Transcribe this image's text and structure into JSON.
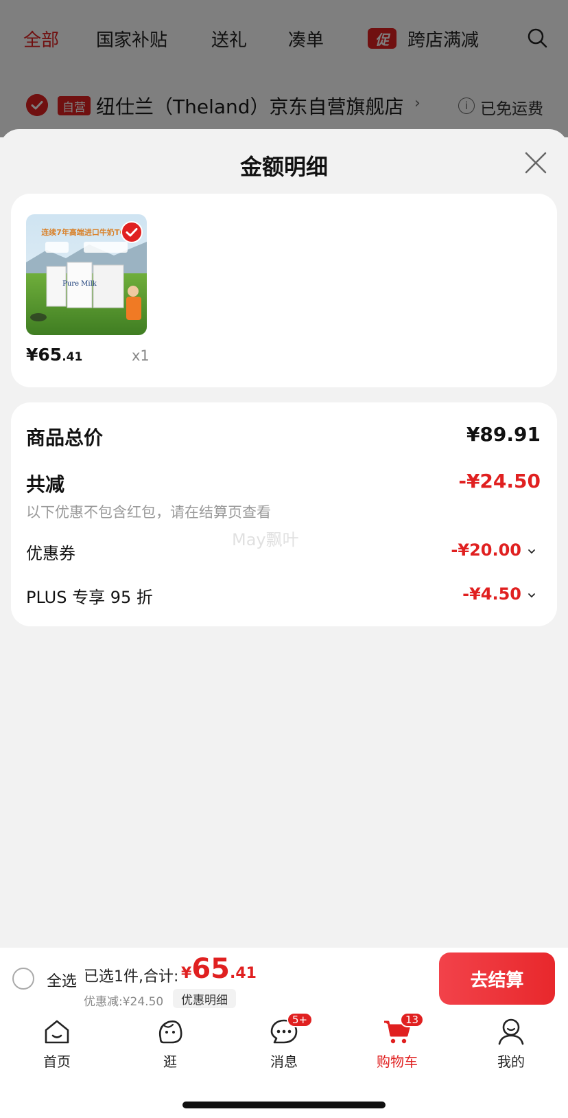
{
  "top_tabs": {
    "all": "全部",
    "national_subsidy": "国家补贴",
    "gift": "送礼",
    "bundle": "凑单",
    "promo_badge": "促",
    "cross_store": "跨店满减"
  },
  "store": {
    "self_operated_badge": "自营",
    "name": "纽仕兰（Theland）京东自营旗舰店",
    "chevron": "›",
    "info_icon": "i",
    "shipping": "已免运费"
  },
  "sheet": {
    "title": "金额明细"
  },
  "product": {
    "price_int": "¥65",
    "price_dec": ".41",
    "quantity": "x1",
    "image_banner": "连续7年高端进口牛奶TOP",
    "image_brand": "Pure Milk"
  },
  "details": {
    "total_label": "商品总价",
    "total_value": "¥89.91",
    "reduce_label": "共减",
    "reduce_value": "-¥24.50",
    "note": "以下优惠不包含红包，请在结算页查看",
    "coupon_label": "优惠券",
    "coupon_value": "-¥20.00",
    "plus_label": "PLUS 专享 95 折",
    "plus_value": "-¥4.50",
    "watermark": "May飘叶"
  },
  "checkout": {
    "select_all": "全选",
    "selected_summary": "已选1件,合计:",
    "price_yen": "¥",
    "price_int": "65",
    "price_dec": ".41",
    "discount_text": "优惠减:¥24.50",
    "discount_detail": "优惠明细",
    "button": "去结算"
  },
  "nav": {
    "home": "首页",
    "browse": "逛",
    "messages": "消息",
    "messages_badge": "5+",
    "cart": "购物车",
    "cart_badge": "13",
    "me": "我的"
  },
  "colors": {
    "accent": "#e02020",
    "background": "#f2f2f2"
  }
}
